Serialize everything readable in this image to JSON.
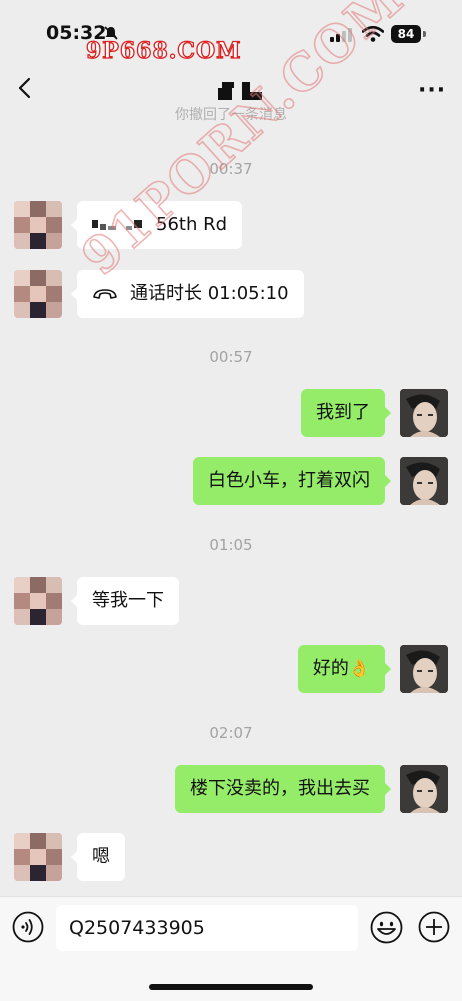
{
  "status_bar": {
    "time": "05:32",
    "battery": "84"
  },
  "watermarks": {
    "top": "9P668.COM",
    "diagonal": "91PORN.COM"
  },
  "header": {
    "back_icon": "chevron-left-icon",
    "title_icon": "pixelated-name",
    "more_label": "···"
  },
  "recalled_notice": "你撤回了一条消息",
  "messages": [
    {
      "type": "timestamp",
      "text": "00:37"
    },
    {
      "from": "contact",
      "text": "56th Rd"
    },
    {
      "from": "contact",
      "text": "通话时长 01:05:10",
      "icon": "phone-hangup-icon"
    },
    {
      "type": "timestamp",
      "text": "00:57"
    },
    {
      "from": "me",
      "text": "我到了"
    },
    {
      "from": "me",
      "text": "白色小车，打着双闪"
    },
    {
      "type": "timestamp",
      "text": "01:05"
    },
    {
      "from": "contact",
      "text": "等我一下"
    },
    {
      "from": "me",
      "text": "好的",
      "emoji": "👌"
    },
    {
      "type": "timestamp",
      "text": "02:07"
    },
    {
      "from": "me",
      "text": "楼下没卖的，我出去买"
    },
    {
      "from": "contact",
      "text": "嗯"
    }
  ],
  "input_bar": {
    "value": "Q2507433905",
    "voice_icon": "voice-icon",
    "emoji_icon": "smile-icon",
    "plus_icon": "plus-circle-icon"
  },
  "colors": {
    "outgoing_bubble": "#95ec69",
    "incoming_bubble": "#ffffff",
    "background": "#ededed"
  }
}
